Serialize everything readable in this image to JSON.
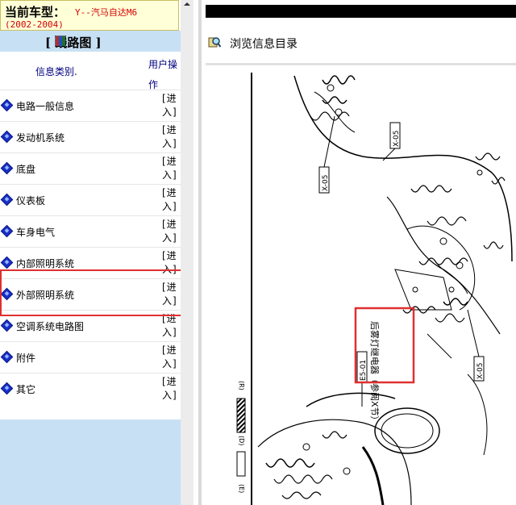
{
  "vehicle": {
    "label": "当前车型：",
    "value": "Y--汽马自达M6",
    "years": "(2002-2004)"
  },
  "section": {
    "title": "[    线路图  ]",
    "icon": "book-icon"
  },
  "columns": {
    "category": "信息类别.",
    "action": "用户操作"
  },
  "categories": [
    {
      "label": "电路一般信息",
      "action": "[进入]"
    },
    {
      "label": "发动机系统",
      "action": "[进入]"
    },
    {
      "label": "底盘",
      "action": "[进入]"
    },
    {
      "label": "仪表板",
      "action": "[进入]"
    },
    {
      "label": "车身电气",
      "action": "[进入]"
    },
    {
      "label": "内部照明系统",
      "action": "[进入]"
    },
    {
      "label": "外部照明系统",
      "action": "[进入]"
    },
    {
      "label": "空调系统电路图",
      "action": "[进入]"
    },
    {
      "label": "附件",
      "action": "[进入]"
    },
    {
      "label": "其它",
      "action": "[进入]"
    }
  ],
  "highlighted_category_index": 6,
  "browse": {
    "label": "浏览信息目录",
    "icon": "magnifier-book-icon"
  },
  "diagram": {
    "callout_text": "后雾灯继电器（参阅X节）",
    "connector_labels": [
      "X-05",
      "X-05",
      "X-05",
      "E5-01"
    ],
    "legend_letters": [
      "(R)",
      "(D)",
      "(E)"
    ]
  },
  "colors": {
    "vehicle_bg": "#ffffd8",
    "header_bg": "#c8e0f4",
    "accent_blue": "#1830c8",
    "highlight_red": "#e03030",
    "value_red": "#d40000"
  }
}
